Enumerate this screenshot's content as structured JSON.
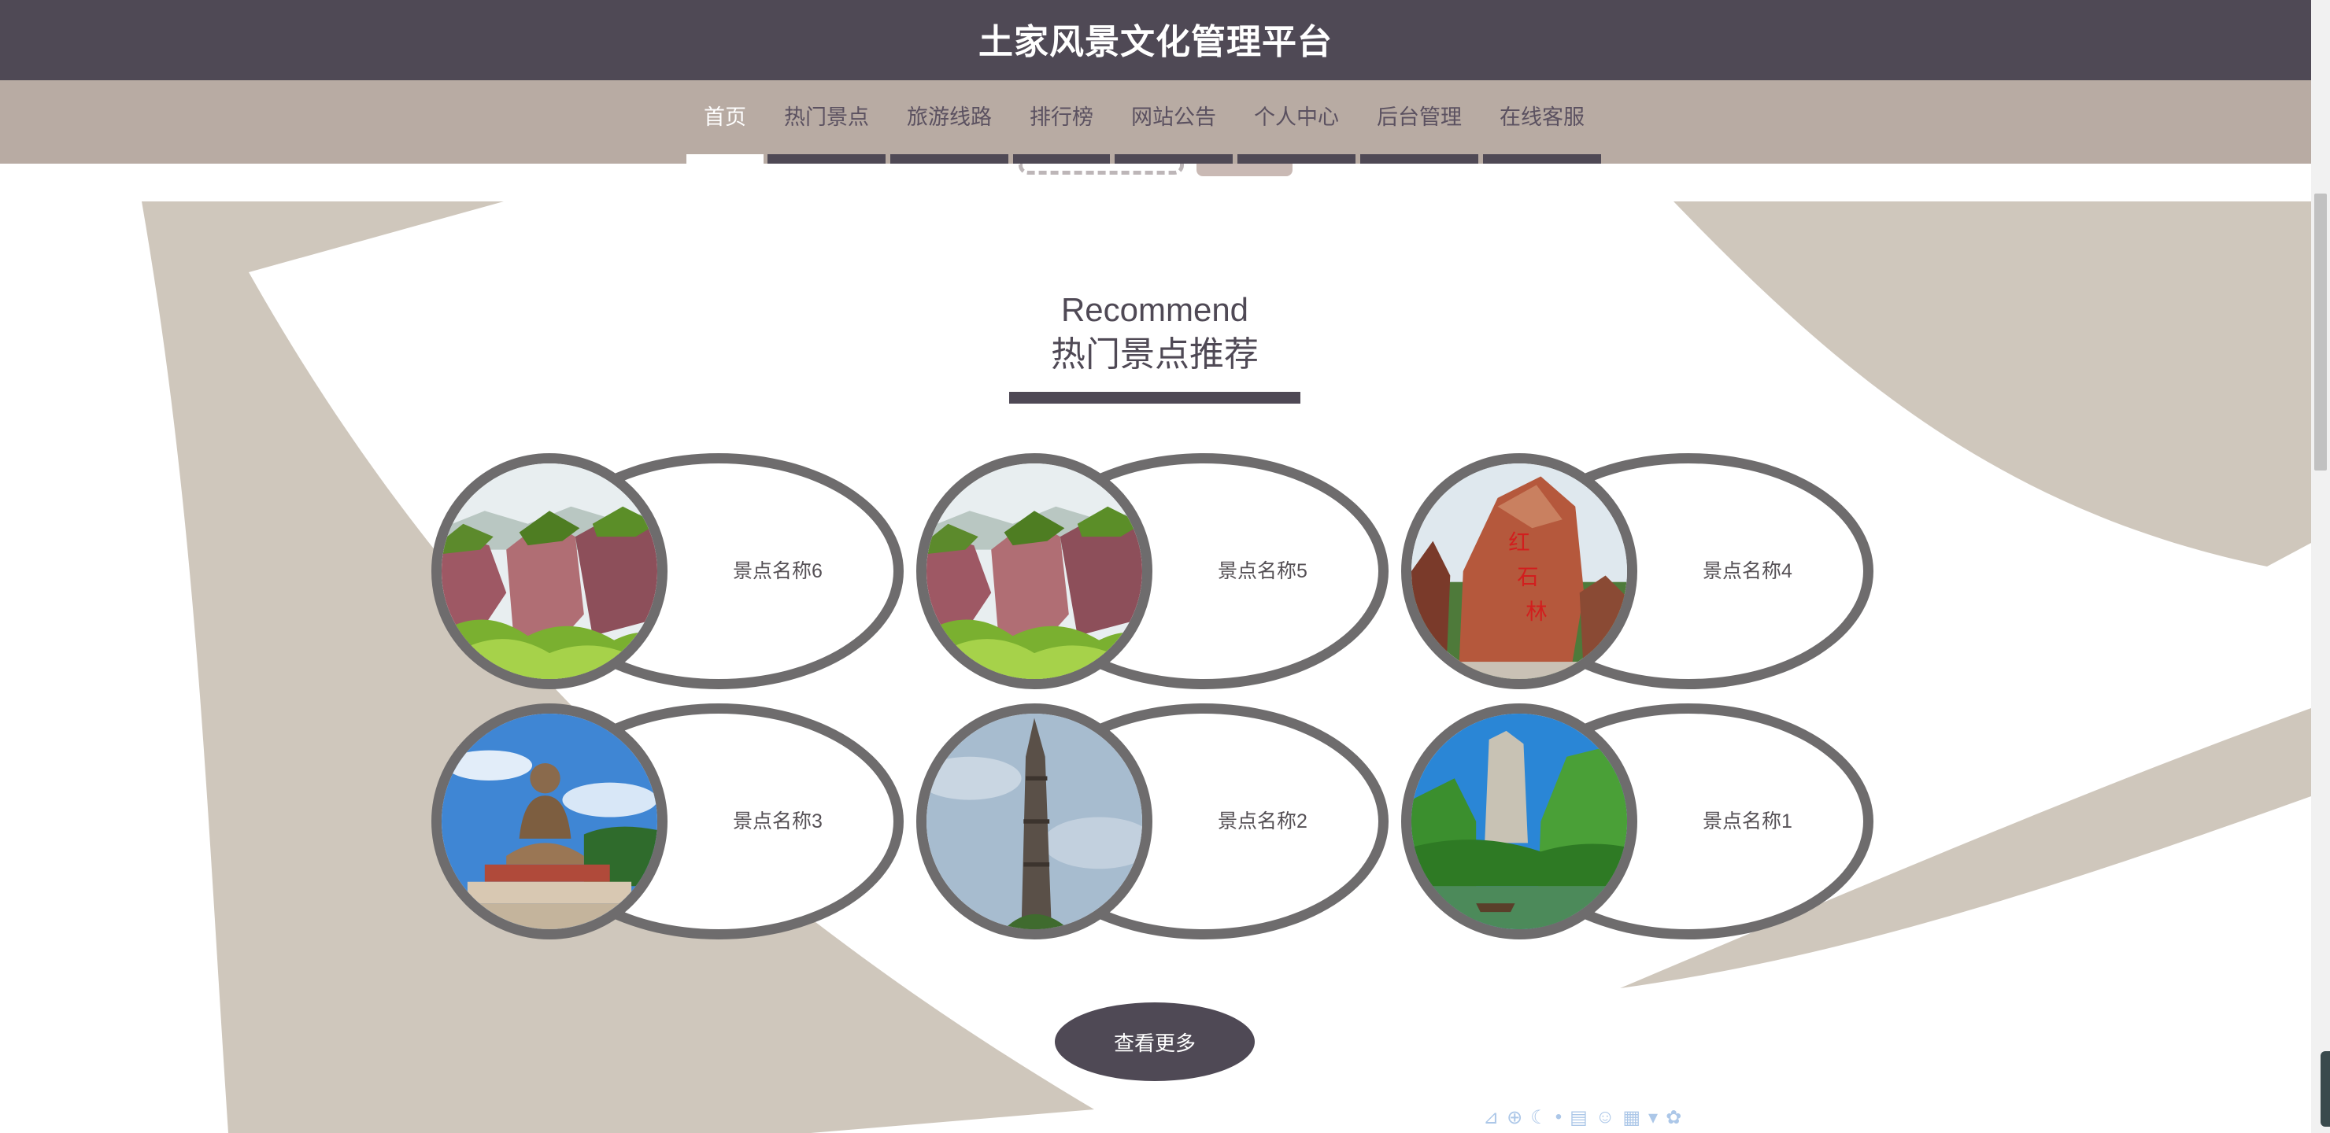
{
  "header": {
    "title": "土家风景文化管理平台"
  },
  "nav": {
    "items": [
      {
        "label": "首页",
        "active": true
      },
      {
        "label": "热门景点"
      },
      {
        "label": "旅游线路"
      },
      {
        "label": "排行榜"
      },
      {
        "label": "网站公告"
      },
      {
        "label": "个人中心"
      },
      {
        "label": "后台管理"
      },
      {
        "label": "在线客服"
      }
    ]
  },
  "section": {
    "title_en": "Recommend",
    "title_cn": "热门景点推荐"
  },
  "spots": [
    {
      "name": "景点名称6",
      "image": "red-cliff-mountain"
    },
    {
      "name": "景点名称5",
      "image": "red-cliff-mountain"
    },
    {
      "name": "景点名称4",
      "image": "inscribed-red-rock"
    },
    {
      "name": "景点名称3",
      "image": "giant-buddha-statue"
    },
    {
      "name": "景点名称2",
      "image": "stone-pillar"
    },
    {
      "name": "景点名称1",
      "image": "karst-peak-lake"
    }
  ],
  "more_button": {
    "label": "查看更多"
  },
  "colors": {
    "header_bg": "#4f4955",
    "nav_bg": "#b8aba3",
    "accent_dark": "#4f4955",
    "decor_beige": "#cfc7bc",
    "card_border": "#6e6c6d"
  }
}
